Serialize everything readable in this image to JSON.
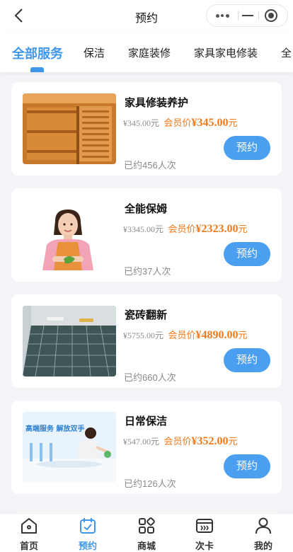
{
  "navbar": {
    "title": "预约",
    "back_icon": "chevron-left-icon",
    "capsule": {
      "more_icon": "more-dots-icon",
      "minimize_icon": "minimize-icon",
      "close_icon": "target-close-icon"
    }
  },
  "tabs": [
    {
      "label": "全部服务",
      "active": true
    },
    {
      "label": "保洁",
      "active": false
    },
    {
      "label": "家庭装修",
      "active": false
    },
    {
      "label": "家具家电修装",
      "active": false
    },
    {
      "label": "全",
      "active": false
    }
  ],
  "colors": {
    "accent": "#3e97ea",
    "button": "#4a9ff0",
    "member_price": "#f27a1a",
    "muted": "#8c8c8c",
    "background": "#f3f4f8"
  },
  "services": [
    {
      "title": "家具修装养护",
      "original_price": "¥345.00元",
      "member_label": "会员价",
      "member_price": "¥345.00",
      "member_unit": "元",
      "booked": "已约456人次",
      "button": "预约",
      "image": "wooden-cabinet-photo"
    },
    {
      "title": "全能保姆",
      "original_price": "¥3345.00元",
      "member_label": "会员价",
      "member_price": "¥2323.00",
      "member_unit": "元",
      "booked": "已约37人次",
      "button": "预约",
      "image": "housekeeper-photo"
    },
    {
      "title": "瓷砖翻新",
      "original_price": "¥5755.00元",
      "member_label": "会员价",
      "member_price": "¥4890.00",
      "member_unit": "元",
      "booked": "已约660人次",
      "button": "预约",
      "image": "tile-floor-photo"
    },
    {
      "title": "日常保洁",
      "original_price": "¥547.00元",
      "member_label": "会员价",
      "member_price": "¥352.00",
      "member_unit": "元",
      "booked": "已约126人次",
      "button": "预约",
      "image": "cleaning-poster-photo",
      "image_text": "高端服务 解放双手"
    }
  ],
  "tabbar": [
    {
      "label": "首页",
      "icon": "home-icon",
      "active": false
    },
    {
      "label": "预约",
      "icon": "calendar-check-icon",
      "active": true
    },
    {
      "label": "商城",
      "icon": "grid-shop-icon",
      "active": false
    },
    {
      "label": "次卡",
      "icon": "card-icon",
      "active": false
    },
    {
      "label": "我的",
      "icon": "user-icon",
      "active": false
    }
  ]
}
